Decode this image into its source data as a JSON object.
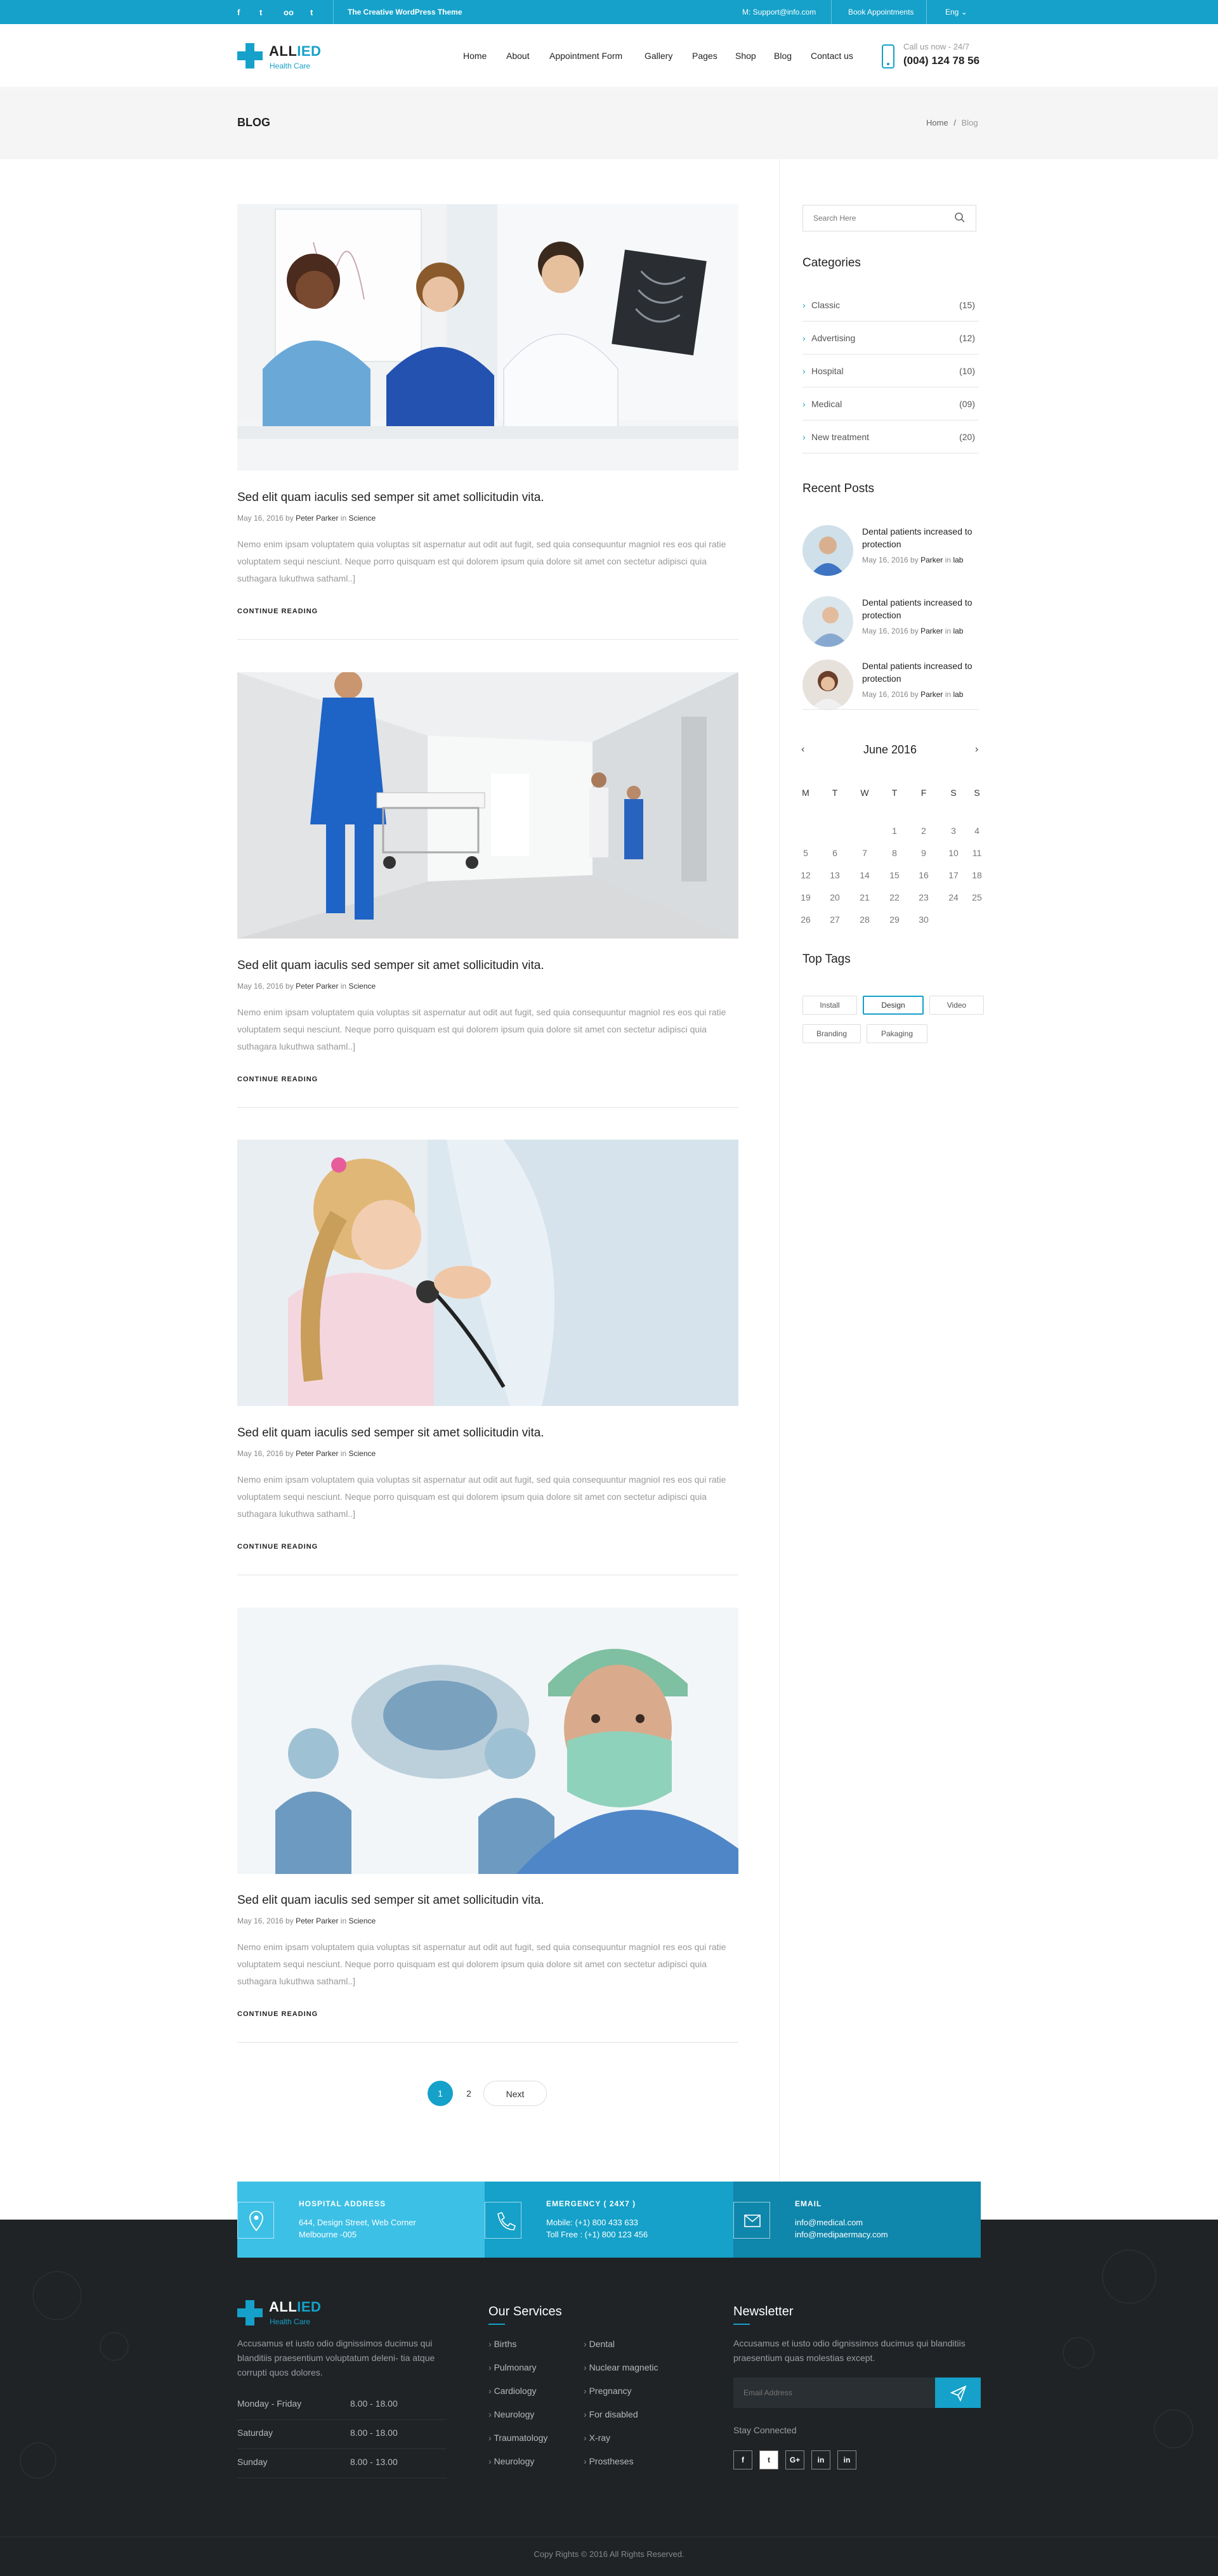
{
  "topbar": {
    "social": [
      "f",
      "t",
      "oo",
      "t"
    ],
    "tagline": "The Creative WordPress Theme",
    "email": "M: Support@info.com",
    "appointments": "Book Appointments",
    "lang": "Eng"
  },
  "header": {
    "logo_main": "ALL",
    "logo_accent": "IED",
    "logo_sub": "Health Care",
    "nav": [
      "Home",
      "About",
      "Appointment Form",
      "Gallery",
      "Pages",
      "Shop",
      "Blog",
      "Contact us"
    ],
    "call_label": "Call us now - 24/7",
    "phone": "(004) 124 78 56"
  },
  "banner": {
    "title": "BLOG",
    "breadcrumb_home": "Home",
    "breadcrumb_sep": "/",
    "breadcrumb_current": "Blog"
  },
  "posts": [
    {
      "title": "Sed elit quam iaculis sed semper sit amet sollicitudin vita.",
      "date": "May 16, 2016 by",
      "author": "Peter Parker",
      "in": "in",
      "category": "Science",
      "excerpt": "Nemo enim ipsam voluptatem quia voluptas sit aspernatur aut odit aut fugit, sed quia consequuntur magnioI res eos qui ratie voluptatem sequi nesciunt.  Neque porro quisquam est qui dolorem ipsum quia dolore sit amet con sectetur adipisci quia suthagara lukuthwa sathaml..]",
      "more": "CONTINUE READING"
    },
    {
      "title": "Sed elit quam iaculis sed semper sit amet sollicitudin vita.",
      "date": "May 16, 2016 by",
      "author": "Peter Parker",
      "in": "in",
      "category": "Science",
      "excerpt": "Nemo enim ipsam voluptatem quia voluptas sit aspernatur aut odit aut fugit, sed quia consequuntur magnioI res eos qui ratie voluptatem sequi nesciunt.  Neque porro quisquam est qui dolorem ipsum quia dolore sit amet con sectetur adipisci quia suthagara lukuthwa sathaml..]",
      "more": "CONTINUE READING"
    },
    {
      "title": "Sed elit quam iaculis sed semper sit amet sollicitudin vita.",
      "date": "May 16, 2016 by",
      "author": "Peter Parker",
      "in": "in",
      "category": "Science",
      "excerpt": "Nemo enim ipsam voluptatem quia voluptas sit aspernatur aut odit aut fugit, sed quia consequuntur magnioI res eos qui ratie voluptatem sequi nesciunt.  Neque porro quisquam est qui dolorem ipsum quia dolore sit amet con sectetur adipisci quia suthagara lukuthwa sathaml..]",
      "more": "CONTINUE READING"
    },
    {
      "title": "Sed elit quam iaculis sed semper sit amet sollicitudin vita.",
      "date": "May 16, 2016 by",
      "author": "Peter Parker",
      "in": "in",
      "category": "Science",
      "excerpt": "Nemo enim ipsam voluptatem quia voluptas sit aspernatur aut odit aut fugit, sed quia consequuntur magnioI res eos qui ratie voluptatem sequi nesciunt.  Neque porro quisquam est qui dolorem ipsum quia dolore sit amet con sectetur adipisci quia suthagara lukuthwa sathaml..]",
      "more": "CONTINUE READING"
    }
  ],
  "pagination": {
    "pages": [
      "1",
      "2"
    ],
    "next": "Next",
    "current": "1"
  },
  "sidebar": {
    "search_placeholder": "Search Here",
    "categories_title": "Categories",
    "categories": [
      {
        "label": "Classic",
        "count": "(15)"
      },
      {
        "label": "Advertising",
        "count": "(12)"
      },
      {
        "label": "Hospital",
        "count": "(10)"
      },
      {
        "label": "Medical",
        "count": "(09)"
      },
      {
        "label": "New treatment",
        "count": "(20)"
      }
    ],
    "recent_title": "Recent Posts",
    "recent": [
      {
        "title": "Dental patients increased to protection",
        "date": "May 16, 2016 by",
        "author": "Parker",
        "in": "in",
        "cat": "lab"
      },
      {
        "title": "Dental patients increased to protection",
        "date": "May 16, 2016 by",
        "author": "Parker",
        "in": "in",
        "cat": "lab"
      },
      {
        "title": "Dental patients increased to protection",
        "date": "May 16, 2016 by",
        "author": "Parker",
        "in": "in",
        "cat": "lab"
      }
    ],
    "calendar": {
      "prev": "‹",
      "next": "›",
      "month": "June 2016",
      "days": [
        "M",
        "T",
        "W",
        "T",
        "F",
        "S",
        "S"
      ],
      "weeks": [
        [
          "",
          "",
          "",
          "1",
          "2",
          "3",
          "4"
        ],
        [
          "5",
          "6",
          "7",
          "8",
          "9",
          "10",
          "11"
        ],
        [
          "12",
          "13",
          "14",
          "15",
          "16",
          "17",
          "18"
        ],
        [
          "19",
          "20",
          "21",
          "22",
          "23",
          "24",
          "25"
        ],
        [
          "26",
          "27",
          "28",
          "29",
          "30",
          "",
          ""
        ]
      ]
    },
    "tags_title": "Top Tags",
    "tags": [
      "Install",
      "Design",
      "Video",
      "Branding",
      "Pakaging"
    ],
    "active_tag": "Design"
  },
  "contact": [
    {
      "title": "HOSPITAL ADDRESS",
      "line1": "644, Design Street, Web Corner",
      "line2": "Melbourne -005",
      "color": "#3dc0e6"
    },
    {
      "title": "EMERGENCY ( 24X7 )",
      "line1": "Mobile: (+1) 800 433 633",
      "line2": "Toll Free : (+1) 800 123 456",
      "color": "#15a1c9"
    },
    {
      "title": "EMAIL",
      "line1": "info@medical.com",
      "line2": "info@medipaermacy.com",
      "color": "#0f86ab"
    }
  ],
  "footer": {
    "about": "Accusamus et iusto odio dignissimos ducimus qui blanditiis praesentium voluptatum deleni- tia atque corrupti quos dolores.",
    "hours": [
      {
        "day": "Monday - Friday",
        "time": "8.00 - 18.00"
      },
      {
        "day": "Saturday",
        "time": "8.00 - 18.00"
      },
      {
        "day": "Sunday",
        "time": "8.00 - 13.00"
      }
    ],
    "services_title": "Our Services",
    "services_col1": [
      "Births",
      "Pulmonary",
      "Cardiology",
      "Neurology",
      "Traumatology",
      "Neurology"
    ],
    "services_col2": [
      "Dental",
      "Nuclear magnetic",
      "Pregnancy",
      "For disabled",
      "X-ray",
      "Prostheses"
    ],
    "newsletter_title": "Newsletter",
    "newsletter_text": "Accusamus et iusto odio dignissimos ducimus qui blanditiis praesentium quas molestias except.",
    "email_placeholder": "Email Address",
    "stay_connected": "Stay Connected",
    "social": [
      "f",
      "t",
      "G+",
      "in",
      "in"
    ],
    "copyright": "Copy Rights © 2016 All Rights Reserved."
  },
  "colors": {
    "accent": "#15a1c9",
    "footer_bg": "#1f2326"
  }
}
